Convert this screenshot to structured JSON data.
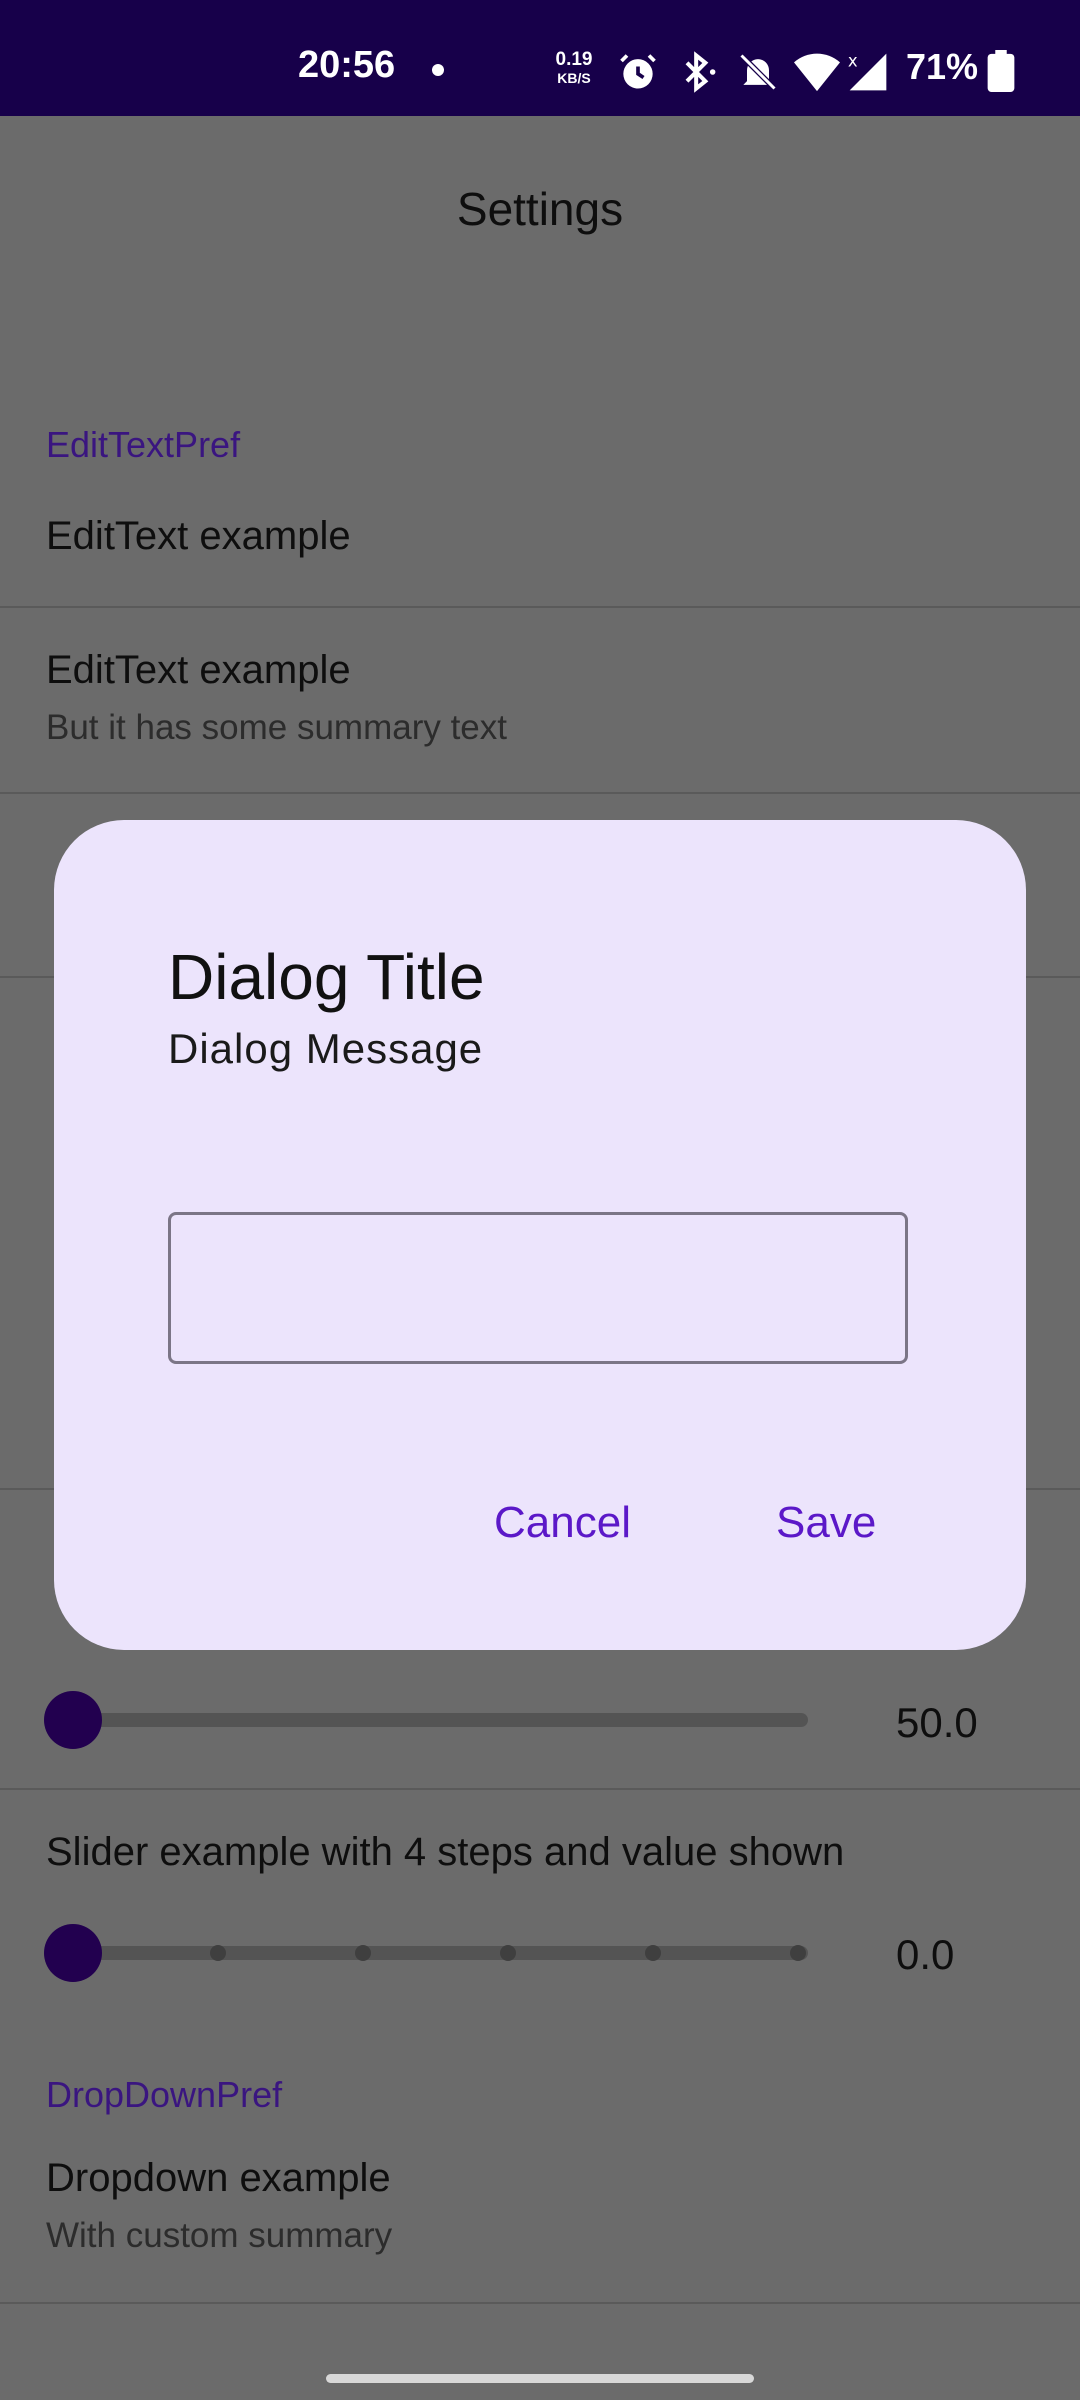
{
  "status_bar": {
    "time": "20:56",
    "net_speed_value": "0.19",
    "net_speed_unit": "KB/S",
    "battery": "71%",
    "icons": [
      "alarm-icon",
      "bluetooth-icon",
      "mute-icon",
      "wifi-icon",
      "signal-icon",
      "battery-icon"
    ]
  },
  "app_bar": {
    "title": "Settings"
  },
  "background": {
    "category_edittext": "EditTextPref",
    "pref_edittext_1_title": "EditText example",
    "pref_edittext_2_title": "EditText example",
    "pref_edittext_2_summary": "But it has some summary text",
    "slider_1_value": "50.0",
    "slider_2_title": "Slider example with 4 steps and value shown",
    "slider_2_value": "0.0",
    "category_dropdown": "DropDownPref",
    "dropdown_title": "Dropdown example",
    "dropdown_summary": "With custom summary"
  },
  "dialog": {
    "title": "Dialog Title",
    "message": "Dialog Message",
    "input_value": "",
    "cancel_label": "Cancel",
    "save_label": "Save"
  },
  "colors": {
    "status_bar": "#17004a",
    "scrim": "#6b6b6b",
    "dialog_surface": "#ece4fc",
    "accent": "#5b18c8",
    "category_text": "#3a1580"
  }
}
